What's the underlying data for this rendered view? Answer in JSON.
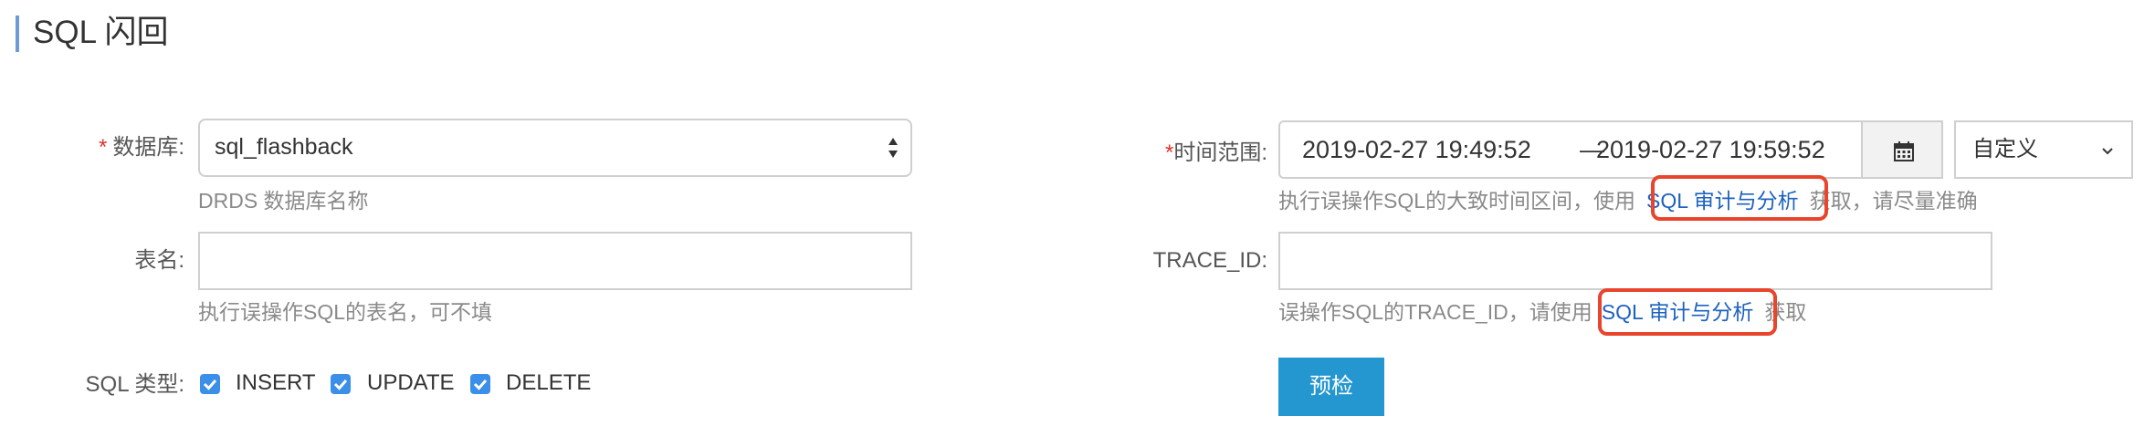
{
  "header": {
    "title": "SQL 闪回"
  },
  "form": {
    "database": {
      "required_mark": "*",
      "label": "数据库:",
      "value": "sql_flashback",
      "hint": "DRDS 数据库名称"
    },
    "table": {
      "label": "表名:",
      "value": "",
      "hint": "执行误操作SQL的表名，可不填"
    },
    "sql_type": {
      "label": "SQL 类型:",
      "options": [
        {
          "label": "INSERT",
          "checked": true
        },
        {
          "label": "UPDATE",
          "checked": true
        },
        {
          "label": "DELETE",
          "checked": true
        }
      ]
    },
    "time_range": {
      "required_mark": "*",
      "label": "时间范围:",
      "start": "2019-02-27 19:49:52",
      "separator": "—",
      "end": "2019-02-27 19:59:52",
      "preset": "自定义",
      "hint_before": "执行误操作SQL的大致时间区间，使用",
      "hint_link": "SQL 审计与分析",
      "hint_after": "获取，请尽量准确"
    },
    "trace_id": {
      "label": "TRACE_ID:",
      "value": "",
      "hint_before": "误操作SQL的TRACE_ID，请使用",
      "hint_link": "SQL 审计与分析",
      "hint_after": "获取"
    },
    "precheck_button": "预检"
  },
  "icons": {
    "calendar": "calendar-icon",
    "select_arrows": "select-arrows-icon",
    "chevron": "chevron-down-icon",
    "check": "check-icon"
  },
  "colors": {
    "accent": "#2496d0",
    "link": "#1c62bf",
    "required": "#e0312e",
    "highlight": "#e8452c",
    "checkbox": "#3b8fe8"
  }
}
